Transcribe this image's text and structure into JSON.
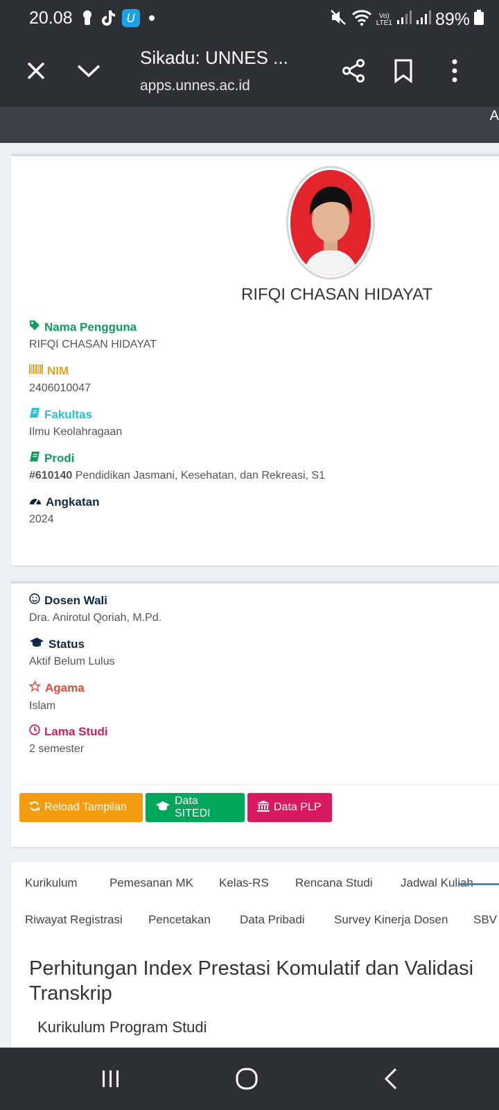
{
  "status_bar": {
    "time": "20.08",
    "battery": "89%",
    "network": "LTE1"
  },
  "browser": {
    "title": "Sikadu: UNNES ...",
    "url": "apps.unnes.ac.id"
  },
  "site_bar": {
    "edge_text": "A"
  },
  "profile": {
    "name": "RIFQI CHASAN HIDAYAT",
    "fields": {
      "username_label": "Nama Pengguna",
      "username_value": "RIFQI CHASAN HIDAYAT",
      "nim_label": "NIM",
      "nim_value": "2406010047",
      "faculty_label": "Fakultas",
      "faculty_value": "Ilmu Keolahragaan",
      "prodi_label": "Prodi",
      "prodi_code": "#610140",
      "prodi_value": "Pendidikan Jasmani, Kesehatan, dan Rekreasi, S1",
      "angkatan_label": "Angkatan",
      "angkatan_value": "2024"
    }
  },
  "academic": {
    "advisor_label": "Dosen Wali",
    "advisor_value": "Dra. Anirotul Qoriah, M.Pd.",
    "status_label": "Status",
    "status_value": "Aktif Belum Lulus",
    "religion_label": "Agama",
    "religion_value": "Islam",
    "duration_label": "Lama Studi",
    "duration_value": "2 semester"
  },
  "buttons": {
    "reload": "Reload Tampilan",
    "sitedi": "Data SITEDI",
    "plp": "Data PLP"
  },
  "tabs": {
    "row1": [
      "Kurikulum",
      "Pemesanan MK",
      "Kelas-RS",
      "Rencana Studi",
      "Jadwal Kuliah"
    ],
    "row2": [
      "Riwayat Registrasi",
      "Pencetakan",
      "Data Pribadi",
      "Survey Kinerja Dosen",
      "SBV"
    ]
  },
  "content": {
    "title": "Perhitungan Index Prestasi Komulatif dan Validasi Transkrip",
    "subtitle": "Kurikulum Program Studi"
  },
  "colors": {
    "green": "#0e9f5c",
    "orange": "#e9a21b",
    "cyan": "#2cbfd0",
    "navy": "#0f2847",
    "red": "#dd4b39",
    "pink": "#d81b60",
    "btn_orange": "#f39c12",
    "btn_green": "#00a65a",
    "btn_pink": "#d81b60"
  }
}
